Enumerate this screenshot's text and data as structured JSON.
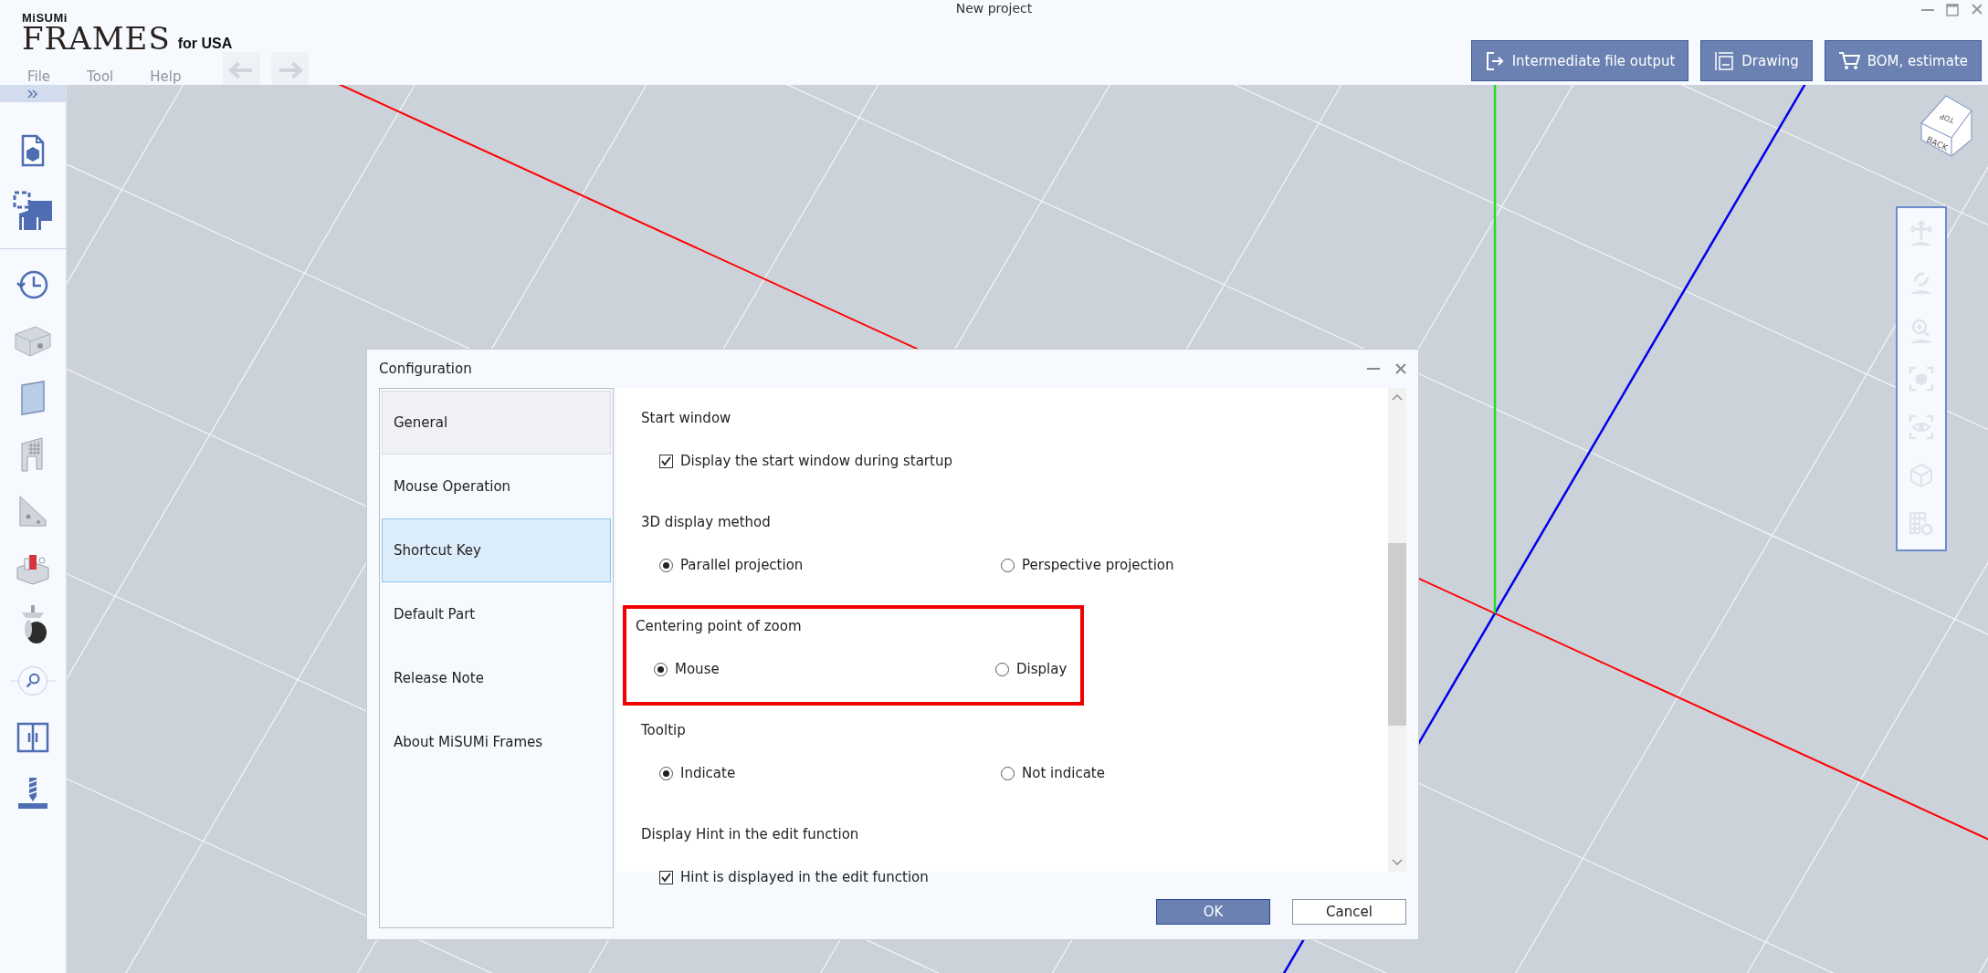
{
  "window": {
    "title": "New project"
  },
  "logo": {
    "brand": "MiSUMi",
    "product": "FRAMES",
    "region": "for USA"
  },
  "menu": [
    {
      "label": "File",
      "disabled": true
    },
    {
      "label": "Tool",
      "disabled": true
    },
    {
      "label": "Help",
      "disabled": true
    }
  ],
  "history_buttons": [
    {
      "kind": "undo",
      "disabled": true
    },
    {
      "kind": "redo",
      "disabled": true
    }
  ],
  "actions": [
    {
      "kind": "export",
      "label": "Intermediate file output"
    },
    {
      "kind": "drawing",
      "label": "Drawing"
    },
    {
      "kind": "cart",
      "label": "BOM, estimate"
    }
  ],
  "view_cube": {
    "top": "TOP",
    "front": "BACK"
  },
  "view_tools": [
    {
      "kind": "pan",
      "disabled": true
    },
    {
      "kind": "rotate",
      "disabled": true
    },
    {
      "kind": "zoom",
      "disabled": true
    },
    {
      "kind": "fit",
      "disabled": true
    },
    {
      "kind": "eye",
      "disabled": true
    },
    {
      "kind": "cube",
      "disabled": true
    },
    {
      "kind": "grid-settings",
      "disabled": true
    }
  ],
  "dialog": {
    "title": "Configuration",
    "nav": [
      {
        "label": "General",
        "selected": false,
        "hovered": true
      },
      {
        "label": "Mouse Operation",
        "selected": false,
        "hovered": false
      },
      {
        "label": "Shortcut Key",
        "selected": true,
        "hovered": false
      },
      {
        "label": "Default Part",
        "selected": false,
        "hovered": false
      },
      {
        "label": "Release Note",
        "selected": false,
        "hovered": false
      },
      {
        "label": "About MiSUMi Frames",
        "selected": false,
        "hovered": false
      }
    ],
    "sections": [
      {
        "title": "Start window",
        "kind": "checkbox",
        "highlighted": false,
        "options": [
          {
            "label": "Display the start window during startup",
            "checked": true
          }
        ]
      },
      {
        "title": "3D display method",
        "kind": "radio",
        "highlighted": false,
        "options": [
          {
            "label": "Parallel projection",
            "selected": true
          },
          {
            "label": "Perspective projection",
            "selected": false
          }
        ]
      },
      {
        "title": "Centering point of zoom",
        "kind": "radio",
        "highlighted": true,
        "options": [
          {
            "label": "Mouse",
            "selected": true
          },
          {
            "label": "Display",
            "selected": false
          }
        ]
      },
      {
        "title": "Tooltip",
        "kind": "radio",
        "highlighted": false,
        "options": [
          {
            "label": "Indicate",
            "selected": true
          },
          {
            "label": "Not indicate",
            "selected": false
          }
        ]
      },
      {
        "title": "Display Hint in the edit function",
        "kind": "checkbox",
        "highlighted": false,
        "options": [
          {
            "label": "Hint is displayed in the edit function",
            "checked": true
          }
        ]
      }
    ],
    "buttons": [
      {
        "label": "OK",
        "primary": true
      },
      {
        "label": "Cancel",
        "primary": false
      }
    ]
  }
}
